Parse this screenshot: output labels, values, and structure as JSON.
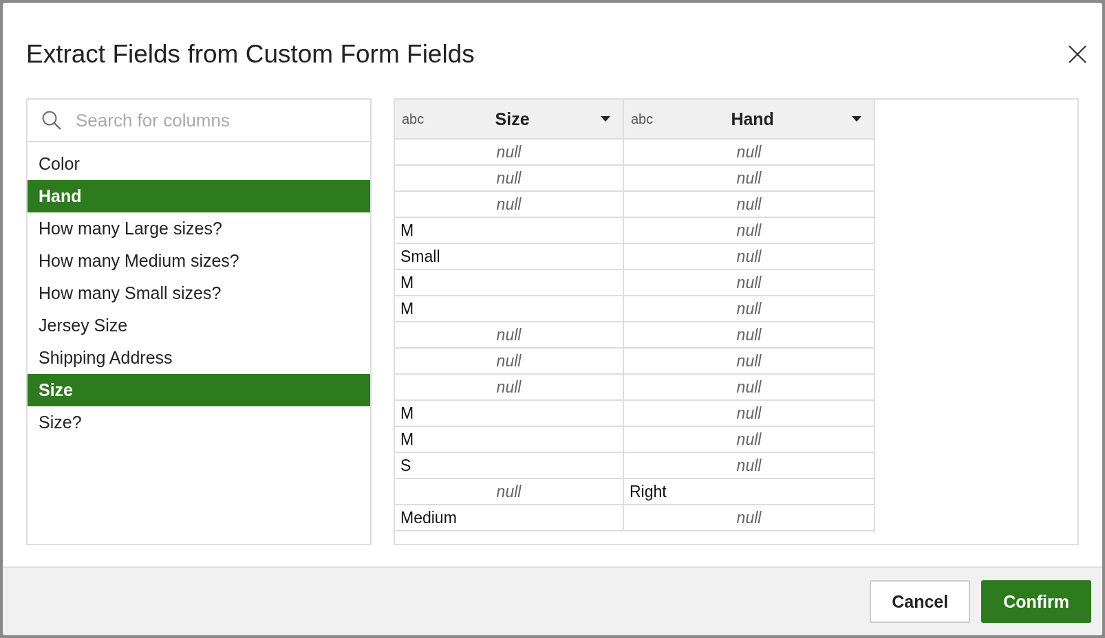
{
  "dialog": {
    "title": "Extract Fields from Custom Form Fields"
  },
  "search": {
    "placeholder": "Search for columns"
  },
  "columns_list": [
    {
      "label": "Color",
      "selected": false
    },
    {
      "label": "Hand",
      "selected": true
    },
    {
      "label": "How many Large sizes?",
      "selected": false
    },
    {
      "label": "How many Medium sizes?",
      "selected": false
    },
    {
      "label": "How many Small sizes?",
      "selected": false
    },
    {
      "label": "Jersey Size",
      "selected": false
    },
    {
      "label": "Shipping Address",
      "selected": false
    },
    {
      "label": "Size",
      "selected": true
    },
    {
      "label": "Size?",
      "selected": false
    }
  ],
  "table": {
    "columns": [
      {
        "type": "abc",
        "name": "Size"
      },
      {
        "type": "abc",
        "name": "Hand"
      }
    ],
    "rows": [
      [
        {
          "text": "null",
          "is_null": true
        },
        {
          "text": "null",
          "is_null": true
        }
      ],
      [
        {
          "text": "null",
          "is_null": true
        },
        {
          "text": "null",
          "is_null": true
        }
      ],
      [
        {
          "text": "null",
          "is_null": true
        },
        {
          "text": "null",
          "is_null": true
        }
      ],
      [
        {
          "text": "M",
          "is_null": false
        },
        {
          "text": "null",
          "is_null": true
        }
      ],
      [
        {
          "text": "Small",
          "is_null": false
        },
        {
          "text": "null",
          "is_null": true
        }
      ],
      [
        {
          "text": "M",
          "is_null": false
        },
        {
          "text": "null",
          "is_null": true
        }
      ],
      [
        {
          "text": "M",
          "is_null": false
        },
        {
          "text": "null",
          "is_null": true
        }
      ],
      [
        {
          "text": "null",
          "is_null": true
        },
        {
          "text": "null",
          "is_null": true
        }
      ],
      [
        {
          "text": "null",
          "is_null": true
        },
        {
          "text": "null",
          "is_null": true
        }
      ],
      [
        {
          "text": "null",
          "is_null": true
        },
        {
          "text": "null",
          "is_null": true
        }
      ],
      [
        {
          "text": "M",
          "is_null": false
        },
        {
          "text": "null",
          "is_null": true
        }
      ],
      [
        {
          "text": "M",
          "is_null": false
        },
        {
          "text": "null",
          "is_null": true
        }
      ],
      [
        {
          "text": "S",
          "is_null": false
        },
        {
          "text": "null",
          "is_null": true
        }
      ],
      [
        {
          "text": "null",
          "is_null": true
        },
        {
          "text": "Right",
          "is_null": false
        }
      ],
      [
        {
          "text": "Medium",
          "is_null": false
        },
        {
          "text": "null",
          "is_null": true
        }
      ]
    ]
  },
  "buttons": [
    {
      "label": "Cancel",
      "kind": "secondary"
    },
    {
      "label": "Confirm",
      "kind": "primary"
    }
  ]
}
